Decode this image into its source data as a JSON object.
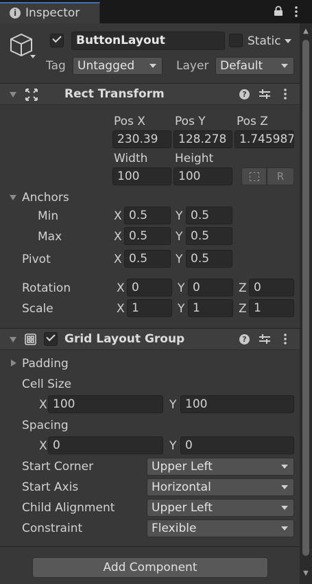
{
  "tab": {
    "title": "Inspector",
    "info_icon": "info-icon",
    "lock_icon": "lock-icon",
    "menu_icon": "kebab-menu-icon"
  },
  "gameobject": {
    "icon": "cube-icon",
    "active": true,
    "name": "ButtonLayout",
    "static_label": "Static",
    "static": false,
    "tag_label": "Tag",
    "tag_value": "Untagged",
    "layer_label": "Layer",
    "layer_value": "Default"
  },
  "rect_transform": {
    "title": "Rect Transform",
    "headers": {
      "pos_x": "Pos X",
      "pos_y": "Pos Y",
      "pos_z": "Pos Z",
      "width": "Width",
      "height": "Height"
    },
    "values": {
      "pos_x": "230.39",
      "pos_y": "128.278",
      "pos_z": "1.745987",
      "width": "100",
      "height": "100"
    },
    "anchors_label": "Anchors",
    "min_label": "Min",
    "min_x": "0.5",
    "min_y": "0.5",
    "max_label": "Max",
    "max_x": "0.5",
    "max_y": "0.5",
    "pivot_label": "Pivot",
    "pivot_x": "0.5",
    "pivot_y": "0.5",
    "rotation_label": "Rotation",
    "rot_x": "0",
    "rot_y": "0",
    "rot_z": "0",
    "scale_label": "Scale",
    "scale_x": "1",
    "scale_y": "1",
    "scale_z": "1",
    "axis_x": "X",
    "axis_y": "Y",
    "axis_z": "Z",
    "raw_edit_label": "R"
  },
  "grid_layout": {
    "title": "Grid Layout Group",
    "enabled": true,
    "padding_label": "Padding",
    "cell_size_label": "Cell Size",
    "cell_x": "100",
    "cell_y": "100",
    "spacing_label": "Spacing",
    "spacing_x": "0",
    "spacing_y": "0",
    "start_corner_label": "Start Corner",
    "start_corner_value": "Upper Left",
    "start_axis_label": "Start Axis",
    "start_axis_value": "Horizontal",
    "child_alignment_label": "Child Alignment",
    "child_alignment_value": "Upper Left",
    "constraint_label": "Constraint",
    "constraint_value": "Flexible"
  },
  "footer": {
    "add_component_label": "Add Component"
  },
  "colors": {
    "panel": "#383838",
    "field": "#2a2a2a",
    "dropdown": "#515151",
    "accent": "#3a72b0"
  }
}
